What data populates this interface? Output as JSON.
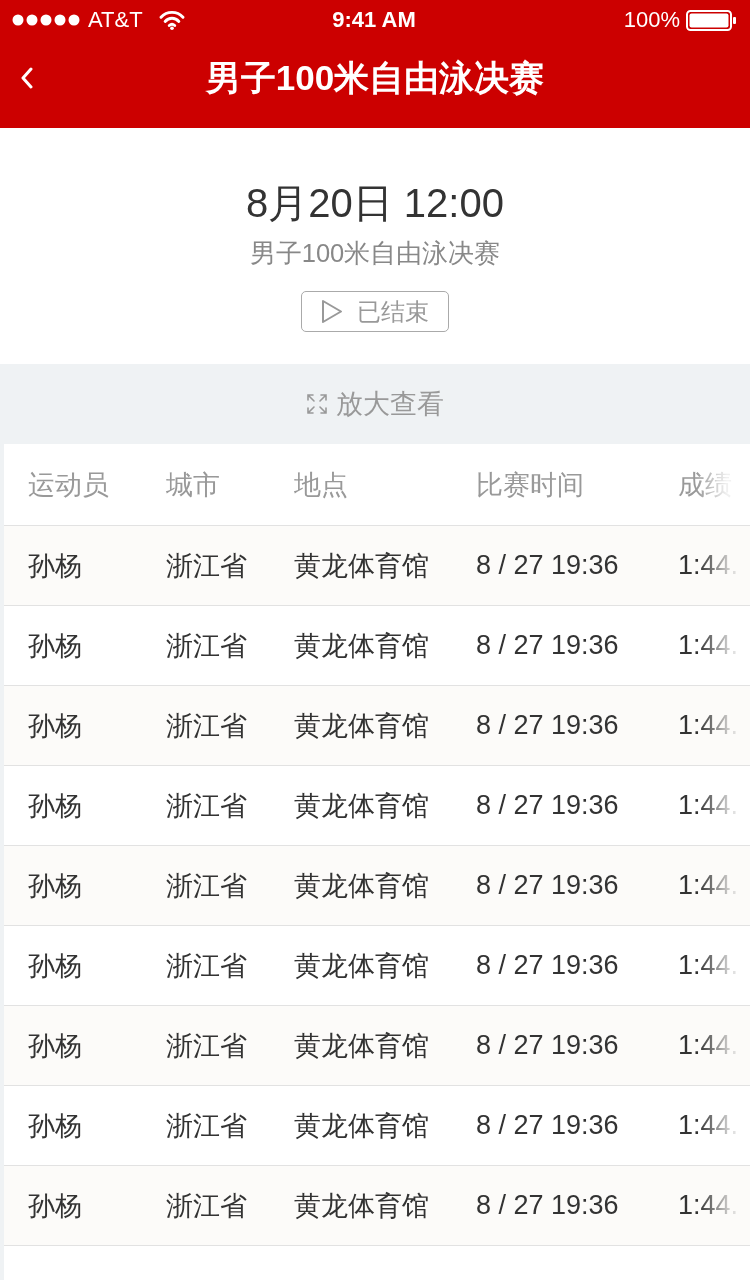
{
  "status_bar": {
    "carrier": "AT&T",
    "time": "9:41 AM",
    "battery": "100%"
  },
  "nav_bar": {
    "title": "男子100米自由泳决赛"
  },
  "event": {
    "datetime": "8月20日 12:00",
    "name": "男子100米自由泳决赛",
    "status": "已结束"
  },
  "zoom_bar": {
    "label": "放大查看"
  },
  "table": {
    "columns": [
      "运动员",
      "城市",
      "地点",
      "比赛时间",
      "成绩"
    ],
    "rows": [
      [
        "孙杨",
        "浙江省",
        "黄龙体育馆",
        "8 / 27 19:36",
        "1:44."
      ],
      [
        "孙杨",
        "浙江省",
        "黄龙体育馆",
        "8 / 27 19:36",
        "1:44."
      ],
      [
        "孙杨",
        "浙江省",
        "黄龙体育馆",
        "8 / 27 19:36",
        "1:44."
      ],
      [
        "孙杨",
        "浙江省",
        "黄龙体育馆",
        "8 / 27 19:36",
        "1:44."
      ],
      [
        "孙杨",
        "浙江省",
        "黄龙体育馆",
        "8 / 27 19:36",
        "1:44."
      ],
      [
        "孙杨",
        "浙江省",
        "黄龙体育馆",
        "8 / 27 19:36",
        "1:44."
      ],
      [
        "孙杨",
        "浙江省",
        "黄龙体育馆",
        "8 / 27 19:36",
        "1:44."
      ],
      [
        "孙杨",
        "浙江省",
        "黄龙体育馆",
        "8 / 27 19:36",
        "1:44."
      ],
      [
        "孙杨",
        "浙江省",
        "黄龙体育馆",
        "8 / 27 19:36",
        "1:44."
      ]
    ]
  }
}
